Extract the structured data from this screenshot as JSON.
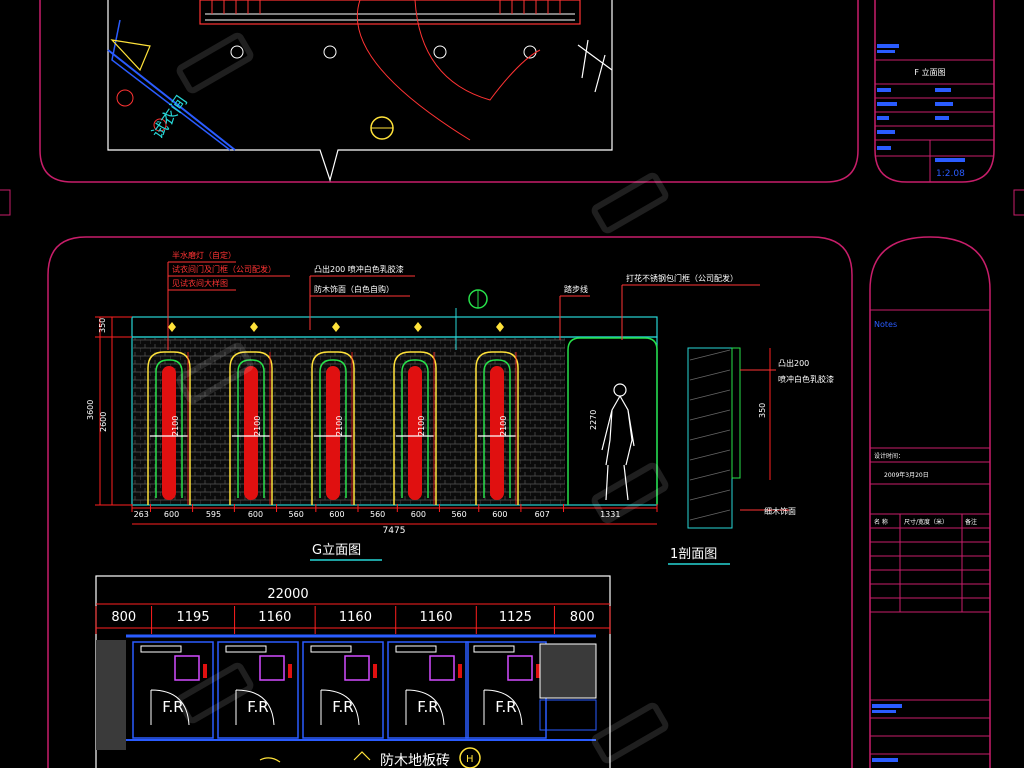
{
  "colors": {
    "background": "#000000",
    "sheet_border": "#c81e6a",
    "dimension": "#ff1f1f",
    "annotation": "#ff3333",
    "cyan": "#27d6d6",
    "yellow": "#ffe23a",
    "green": "#27e04a",
    "white": "#ffffff",
    "magenta": "#d34cff",
    "blue": "#2a5cff"
  },
  "top_sheet": {
    "side_text": "试衣间",
    "title_block": {
      "view_title": "F 立面图",
      "scale": "1:2.08"
    }
  },
  "middle_sheet": {
    "elevation_title": "G立面图",
    "section_title": "1剖面图",
    "callouts": [
      "半水磨灯（自定）",
      "试衣间门及门框（公司配发）",
      "见试衣间大样图",
      "凸出200 喷冲白色乳胶漆",
      "防木饰面（白色自购）",
      "踏步线",
      "打花不锈钢包门框（公司配发）"
    ],
    "section_callout": [
      "凸出200",
      "喷冲白色乳胶漆"
    ],
    "section_bottom_note": "细木饰面",
    "overall_height_labels": [
      "3600",
      "2600"
    ],
    "top_band_label": "350",
    "door_height_label": "2100",
    "figure_height_label": "2270",
    "section_dim": "350",
    "bottom_dims": [
      "263",
      "600",
      "595",
      "600",
      "560",
      "600",
      "560",
      "600",
      "560",
      "600",
      "607",
      "1331"
    ],
    "overall_width": "7475",
    "title_block": {
      "notes_label": "Notes",
      "date_label": "设计时间：",
      "date_value": "2009年3月20日",
      "table_headers": [
        "名 称",
        "尺寸/宽度（米）",
        "备注"
      ]
    }
  },
  "plan_sheet": {
    "overall_dim": "22000",
    "segment_dims": [
      "800",
      "1195",
      "1160",
      "1160",
      "1160",
      "1125",
      "800"
    ],
    "rooms": [
      "F.R",
      "F.R",
      "F.R",
      "F.R",
      "F.R"
    ],
    "floor_label": "防木地板砖",
    "marker_letter": "H"
  }
}
